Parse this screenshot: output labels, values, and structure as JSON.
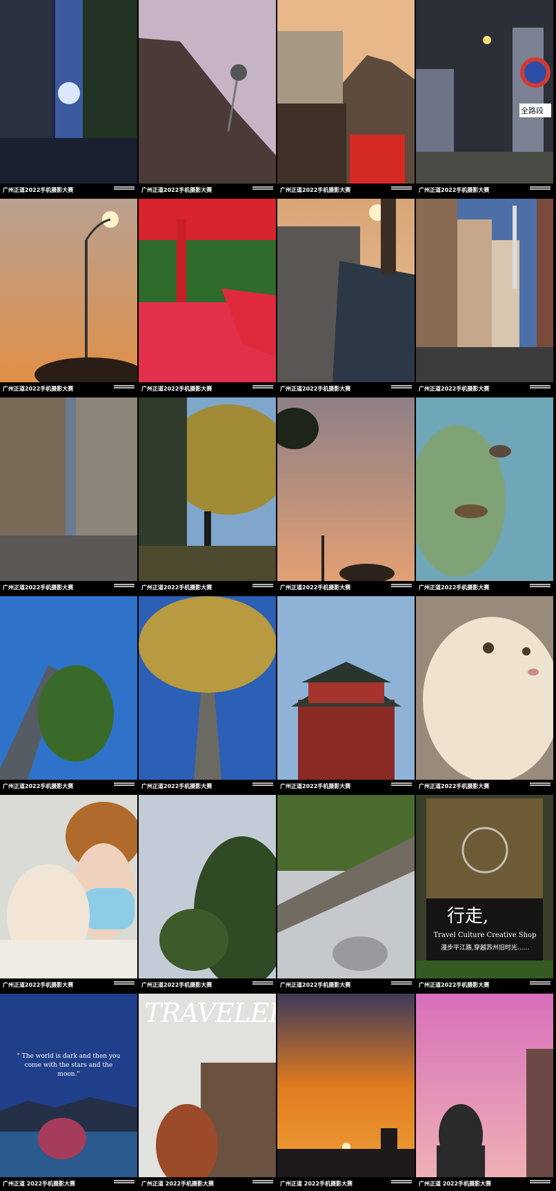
{
  "caption": "广州正道2022手机摄影大赛",
  "captions_row6": [
    "广州正道 2022手机摄影大赛",
    "广州正道 2022手机摄影大赛",
    "广州正道 2022手机摄影大赛",
    "广州正道 2022手机摄影大赛"
  ],
  "signs": {
    "road": "全路段",
    "shop_title": "行走,",
    "shop_name": "Travel Culture Creative Shop",
    "shop_slogan": "漫步平江路,穿越苏州旧时光......",
    "poem": "\" The world is dark and then you come with the stars and the moon.\"",
    "traveler": "TRAVELER"
  },
  "colors": {
    "bar": "#000000",
    "text": "#ffffff"
  }
}
